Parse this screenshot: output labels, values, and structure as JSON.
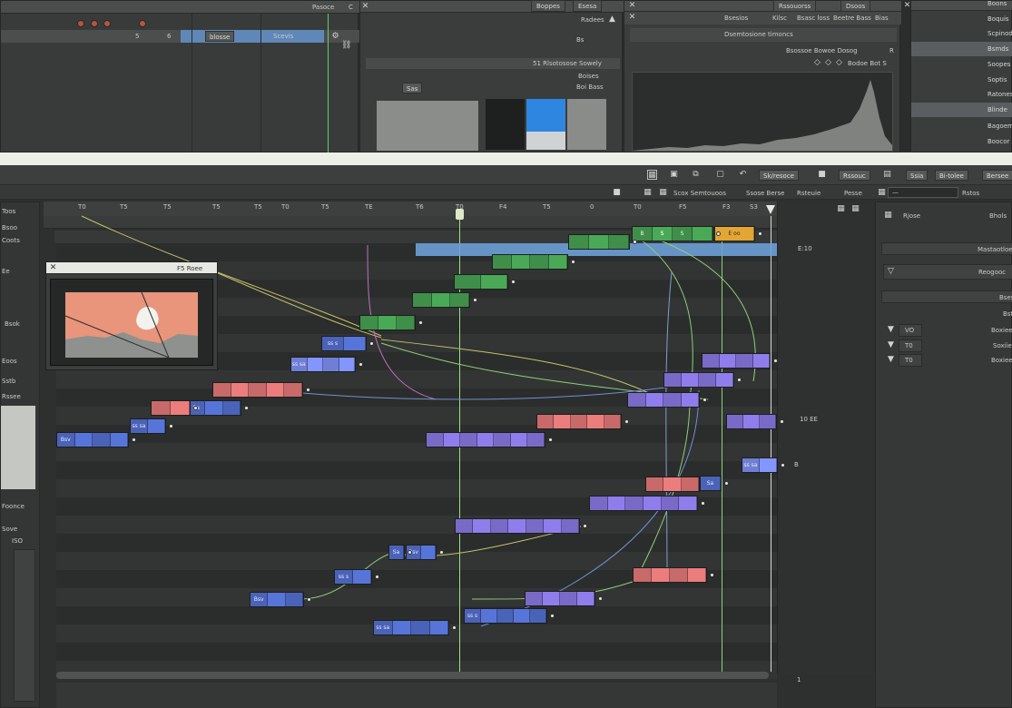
{
  "top_left": {
    "title": "Pasoce",
    "close_label": "C",
    "col_label_1": "Scevis",
    "col_label_2": "blosse",
    "row_num": "5",
    "row_note": "6"
  },
  "top_mid": {
    "tabs": [
      "Esesa",
      "Boppes"
    ],
    "header_label": "Radees",
    "sub_label": "Bs",
    "section_label": "51 Rlsotosose Sowely",
    "list_title": "Boises",
    "list_sub": "Boi Bass",
    "swatch_btn": "Sas"
  },
  "top_right_panel": {
    "tabs": [
      "Dsoos",
      "Rssouorss"
    ],
    "header_items": [
      "Bias",
      "Beetre Bass",
      "Bsasc loss",
      "Kilsc",
      "Bsesios"
    ],
    "line1": "Dsemtosione timoncs",
    "line2": "Bsossoe Bowoe Dosog",
    "line3": "Bodoe Bot S",
    "line2_prefix": "R"
  },
  "far_right_list": {
    "items": [
      "Boons",
      "Boquis",
      "Scpinod",
      "Bsmds",
      "Soopes",
      "Soptis",
      "Ratones",
      "Blinde",
      "Bagoemer",
      "Boocor"
    ],
    "selected": [
      3,
      7
    ]
  },
  "toolbar": {
    "buttons": [
      "Bersee",
      "Bi-tolee",
      "Ssia",
      "Rssouc",
      "Sk/resoce"
    ]
  },
  "subtoolbar": {
    "items": [
      "Rstos",
      "Pesse",
      "Rsteuie",
      "Ssose Berse",
      "Scox Semtouoos"
    ]
  },
  "ruler": {
    "labels": [
      "T0",
      "T5",
      "T5",
      "T5",
      "T5",
      "T0",
      "T5",
      "TE",
      "T6",
      "T0",
      "F4",
      "T5",
      "0",
      "T0",
      "F5",
      "F3",
      "S3"
    ]
  },
  "preview_window": {
    "title": "F5 Roee",
    "close_icon": "close-icon"
  },
  "left_strip": {
    "items": [
      "Toos",
      "Bsoo",
      "Coots",
      "Ee",
      "Bsok",
      "Eoos",
      "Sstb",
      "Rssee",
      "Foonce",
      "Sove",
      "ISO"
    ]
  },
  "right_props": {
    "title_top": "Rjose",
    "title_top2": "Bhols",
    "label1": "Mastaotloes",
    "dropdown": "Reogooc",
    "label2": "Bses",
    "label3": "Bst",
    "rows": [
      {
        "value": "VO",
        "label": "Boxiee"
      },
      {
        "value": "T0",
        "label": "Soxiie"
      },
      {
        "value": "T0",
        "label": "Boxiee"
      }
    ]
  },
  "graph_markers": {
    "right_a": "10 EE",
    "right_b": "B",
    "right_c": "E:10",
    "bottom": "1"
  },
  "nodes": {
    "orange": "E oo",
    "green_top": [
      "B",
      "S",
      "S"
    ],
    "blue_labels": [
      "ss sa",
      "Bsv",
      "Sa",
      "ss s"
    ]
  },
  "colors": {
    "bg": "#2b2d2c",
    "panel": "#3a3d3b",
    "blue": "#4a63b8",
    "green": "#3f8f4a",
    "red": "#c86a6a",
    "violet": "#7a6ac8",
    "orange": "#e3a635",
    "selection": "#6ea0d8"
  }
}
